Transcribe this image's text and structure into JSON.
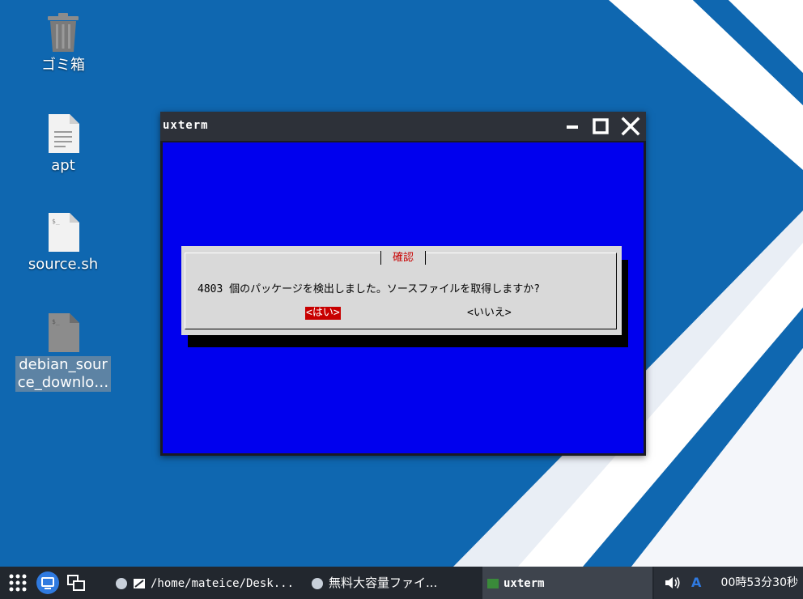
{
  "desktop": {
    "colors": {
      "background": "#0f67b0",
      "stripe": "#ffffff",
      "light_panel": "#e9eef5"
    },
    "icons": [
      {
        "label": "ゴミ箱",
        "icon": "trash-icon"
      },
      {
        "label": "apt",
        "icon": "text-file-icon"
      },
      {
        "label": "source.sh",
        "icon": "shell-script-icon"
      },
      {
        "label_line1": "debian_sour",
        "label_line2": "ce_downlo…",
        "icon": "shell-script-icon",
        "selected": true
      }
    ]
  },
  "window": {
    "title": "uxterm",
    "buttons": [
      "minimize-icon",
      "maximize-icon",
      "close-icon"
    ],
    "colors": {
      "titlebar": "#2d3139",
      "terminal_bg": "#0000ee"
    }
  },
  "dialog": {
    "title": "確認",
    "message": "4803 個のパッケージを検出しました。ソースファイルを取得しますか?",
    "yes_label": "<はい>",
    "no_label": "<いいえ>",
    "colors": {
      "background": "#d9d9d9",
      "accent": "#c80000"
    }
  },
  "taskbar": {
    "launchers": [
      "app-grid-icon",
      "show-desktop-icon",
      "window-switcher-icon"
    ],
    "tasks": [
      {
        "label": "/home/mateice/Desk...",
        "icon": "file-manager-icon"
      },
      {
        "label": "無料大容量ファイ...",
        "icon": "browser-icon"
      },
      {
        "label": "uxterm",
        "icon": "terminal-icon",
        "active": true
      }
    ],
    "tray": {
      "volume": "volume-icon",
      "ime": "A",
      "clock": "00時53分30秒"
    }
  }
}
